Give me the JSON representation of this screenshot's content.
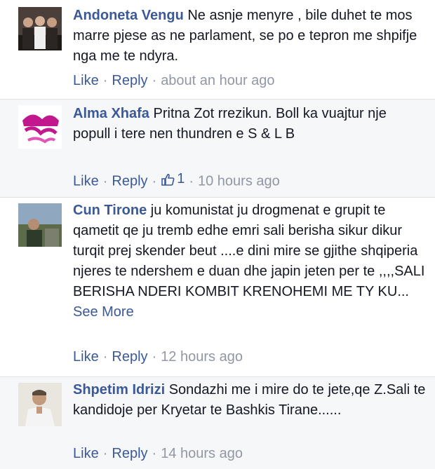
{
  "comments": [
    {
      "author": "Andoneta Vengu",
      "text": "Ne asnje menyre , bile duhet te mos marre pjese as ne parlament, se po e tepron me shpifje nga me te ndyra.",
      "like": "Like",
      "reply": "Reply",
      "time": "about an hour ago"
    },
    {
      "author": "Alma Xhafa",
      "text": "Pritna Zot rrezikun. Boll ka vuajtur nje popull i tere nen thundren e S & L B",
      "like": "Like",
      "reply": "Reply",
      "like_count": "1",
      "time": "10 hours ago"
    },
    {
      "author": "Cun Tirone",
      "text": "ju komunistat ju drogmenat e grupit te qametit qe ju tremb edhe emri sali berisha sikur dikur turqit prej skender beut ....e dini mire se gjithe shqiperia njeres te ndershem e duan dhe japin jeten per te ,,,,SALI BERISHA NDERI KOMBIT KRENOHEMI ME TY KU...",
      "see_more": "See More",
      "like": "Like",
      "reply": "Reply",
      "time": "12 hours ago"
    },
    {
      "author": "Shpetim Idrizi",
      "text": "Sondazhi me i mire do te jete,qe Z.Sali te kandidoje per Kryetar te Bashkis Tirane......",
      "like": "Like",
      "reply": "Reply",
      "time": "14 hours ago"
    }
  ],
  "colors": {
    "link": "#3b5998",
    "meta": "#9197a3",
    "text": "#141823",
    "alt_bg": "#f6f7f9"
  },
  "icons": [
    "thumbs-up-icon"
  ]
}
